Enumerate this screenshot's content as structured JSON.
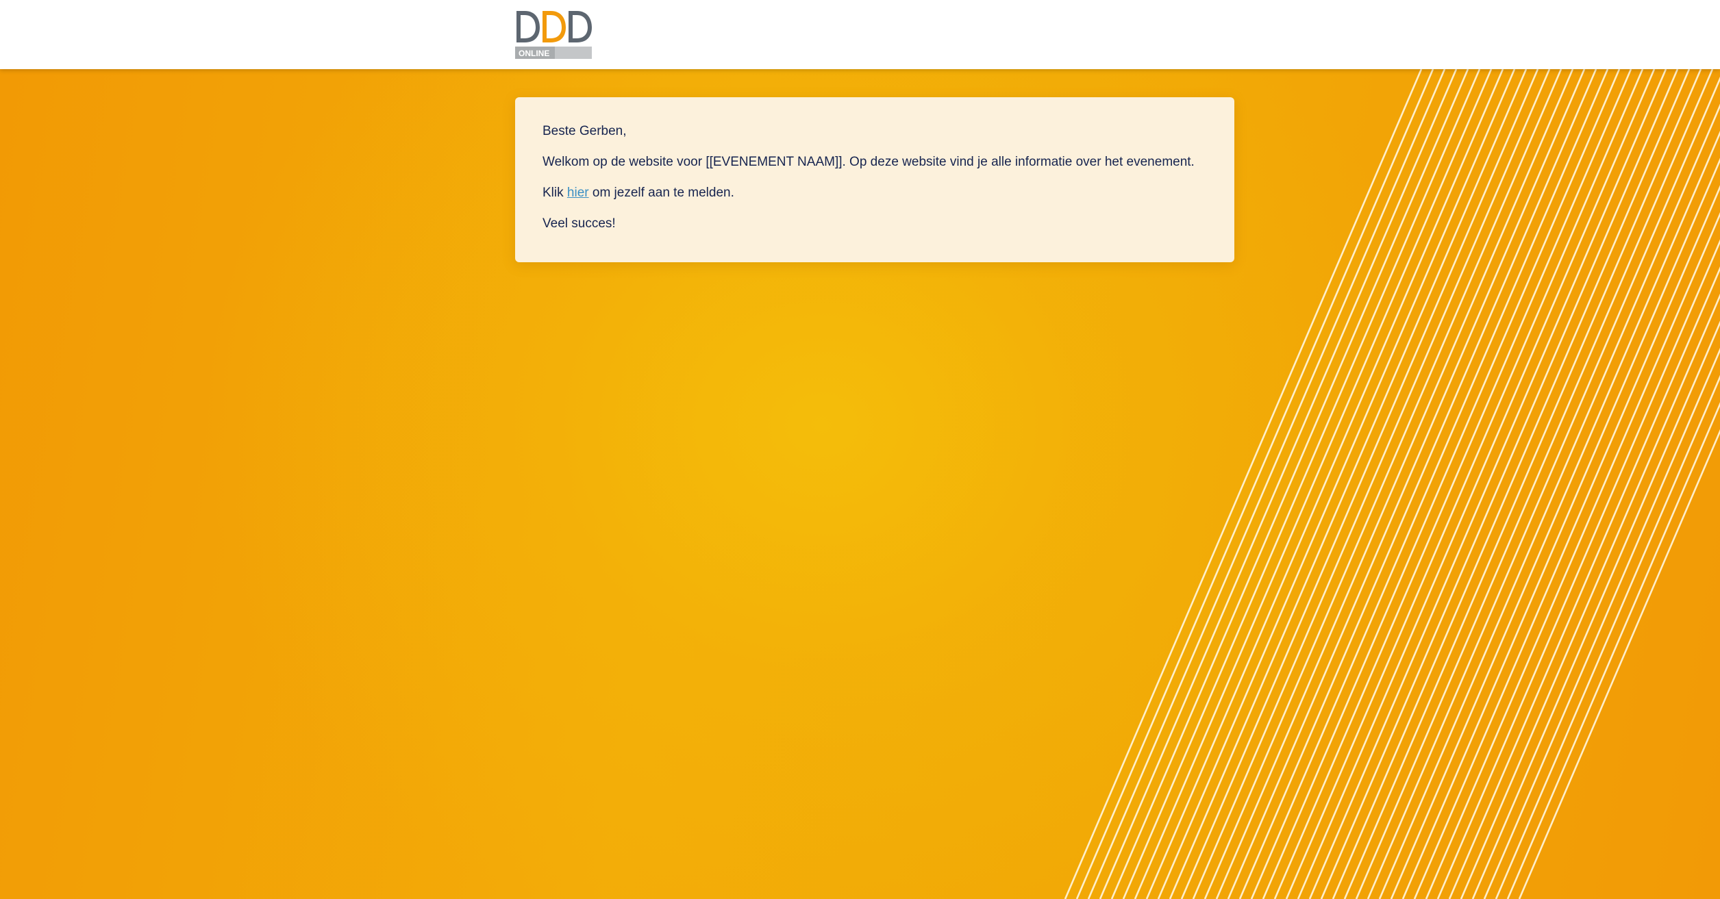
{
  "header": {
    "logo": {
      "letters": [
        "D",
        "D",
        "D"
      ],
      "subtitle": "ONLINE",
      "colors": {
        "gray": "#5d6670",
        "orange": "#f29a0c",
        "badge": "#c4c6c8"
      }
    }
  },
  "message": {
    "greeting": "Beste Gerben,",
    "welcome": "Welkom op de website voor [[EVENEMENT NAAM]]. Op deze website vind je alle informatie over het evenement.",
    "register_prefix": "Klik ",
    "register_link": "hier",
    "register_suffix": " om jezelf aan te melden.",
    "closing": "Veel succes!"
  },
  "theme": {
    "background": "#f2a30a",
    "card_background": "#fcf1dc",
    "text_color": "#16244f",
    "link_color": "#3a8fc4"
  }
}
